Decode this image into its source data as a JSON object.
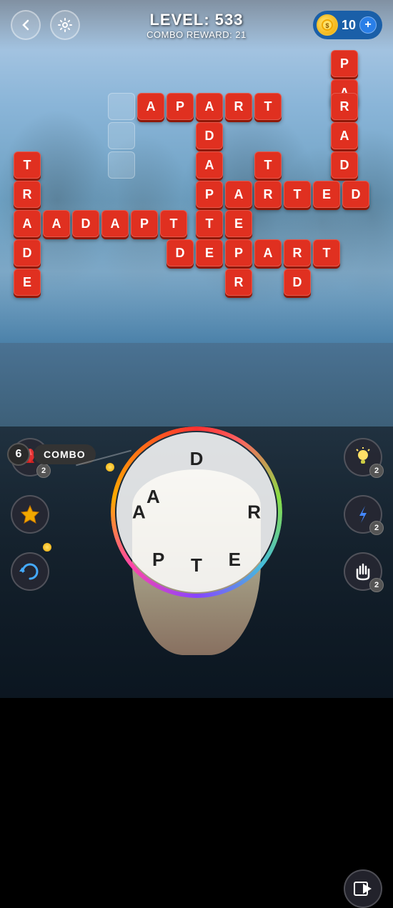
{
  "header": {
    "level_label": "LEVEL: 533",
    "combo_reward_label": "COMBO REWARD: 21",
    "coin_count": "10",
    "back_icon": "←",
    "settings_icon": "⚙",
    "plus_icon": "+"
  },
  "combo": {
    "number": "6",
    "label": "COMBO"
  },
  "wheel": {
    "letters": [
      "D",
      "R",
      "E",
      "P",
      "T",
      "A",
      "A"
    ]
  },
  "tiles": [
    {
      "letter": "A",
      "col": 5,
      "row": 2
    },
    {
      "letter": "P",
      "col": 5,
      "row": 3
    },
    {
      "letter": "A",
      "col": 5,
      "row": 4
    },
    {
      "letter": "R",
      "col": 5,
      "row": 5
    },
    {
      "letter": "A",
      "col": 5,
      "row": 6
    },
    {
      "letter": "D",
      "col": 5,
      "row": 7
    },
    {
      "letter": "A",
      "col": 1,
      "row": 2
    },
    {
      "letter": "P",
      "col": 2,
      "row": 2
    },
    {
      "letter": "A",
      "col": 3,
      "row": 2
    },
    {
      "letter": "R",
      "col": 4,
      "row": 2
    },
    {
      "letter": "T",
      "col": 5,
      "row": 2
    },
    {
      "letter": "D",
      "col": 3,
      "row": 3
    },
    {
      "letter": "A",
      "col": 3,
      "row": 4
    },
    {
      "letter": "T",
      "col": 4,
      "row": 4
    },
    {
      "letter": "T",
      "col": 0,
      "row": 3
    },
    {
      "letter": "R",
      "col": 0,
      "row": 4
    },
    {
      "letter": "A",
      "col": 0,
      "row": 5
    },
    {
      "letter": "D",
      "col": 0,
      "row": 6
    },
    {
      "letter": "E",
      "col": 0,
      "row": 7
    },
    {
      "letter": "P",
      "col": 3,
      "row": 5
    },
    {
      "letter": "A",
      "col": 4,
      "row": 5
    },
    {
      "letter": "R",
      "col": 5,
      "row": 5
    },
    {
      "letter": "T",
      "col": 6,
      "row": 5
    },
    {
      "letter": "E",
      "col": 7,
      "row": 5
    },
    {
      "letter": "D",
      "col": 8,
      "row": 5
    },
    {
      "letter": "A",
      "col": 1,
      "row": 5
    },
    {
      "letter": "D",
      "col": 2,
      "row": 5
    },
    {
      "letter": "A",
      "col": 3,
      "row": 5
    },
    {
      "letter": "P",
      "col": 4,
      "row": 5
    },
    {
      "letter": "T",
      "col": 5,
      "row": 5
    },
    {
      "letter": "T",
      "col": 3,
      "row": 6
    },
    {
      "letter": "E",
      "col": 4,
      "row": 6
    },
    {
      "letter": "D",
      "col": 2,
      "row": 7
    },
    {
      "letter": "E",
      "col": 3,
      "row": 7
    },
    {
      "letter": "P",
      "col": 4,
      "row": 7
    },
    {
      "letter": "A",
      "col": 5,
      "row": 7
    },
    {
      "letter": "R",
      "col": 6,
      "row": 7
    },
    {
      "letter": "T",
      "col": 7,
      "row": 7
    },
    {
      "letter": "R",
      "col": 3,
      "row": 8
    },
    {
      "letter": "D",
      "col": 4,
      "row": 8
    }
  ],
  "side_buttons": {
    "rocket_label": "🚀",
    "rocket_badge": "2",
    "star_label": "⭐",
    "lightning_label": "⚡",
    "lightning_badge": "2",
    "refresh_label": "🔄",
    "hand_label": "👆",
    "hand_badge": "2",
    "video_label": "▶"
  }
}
